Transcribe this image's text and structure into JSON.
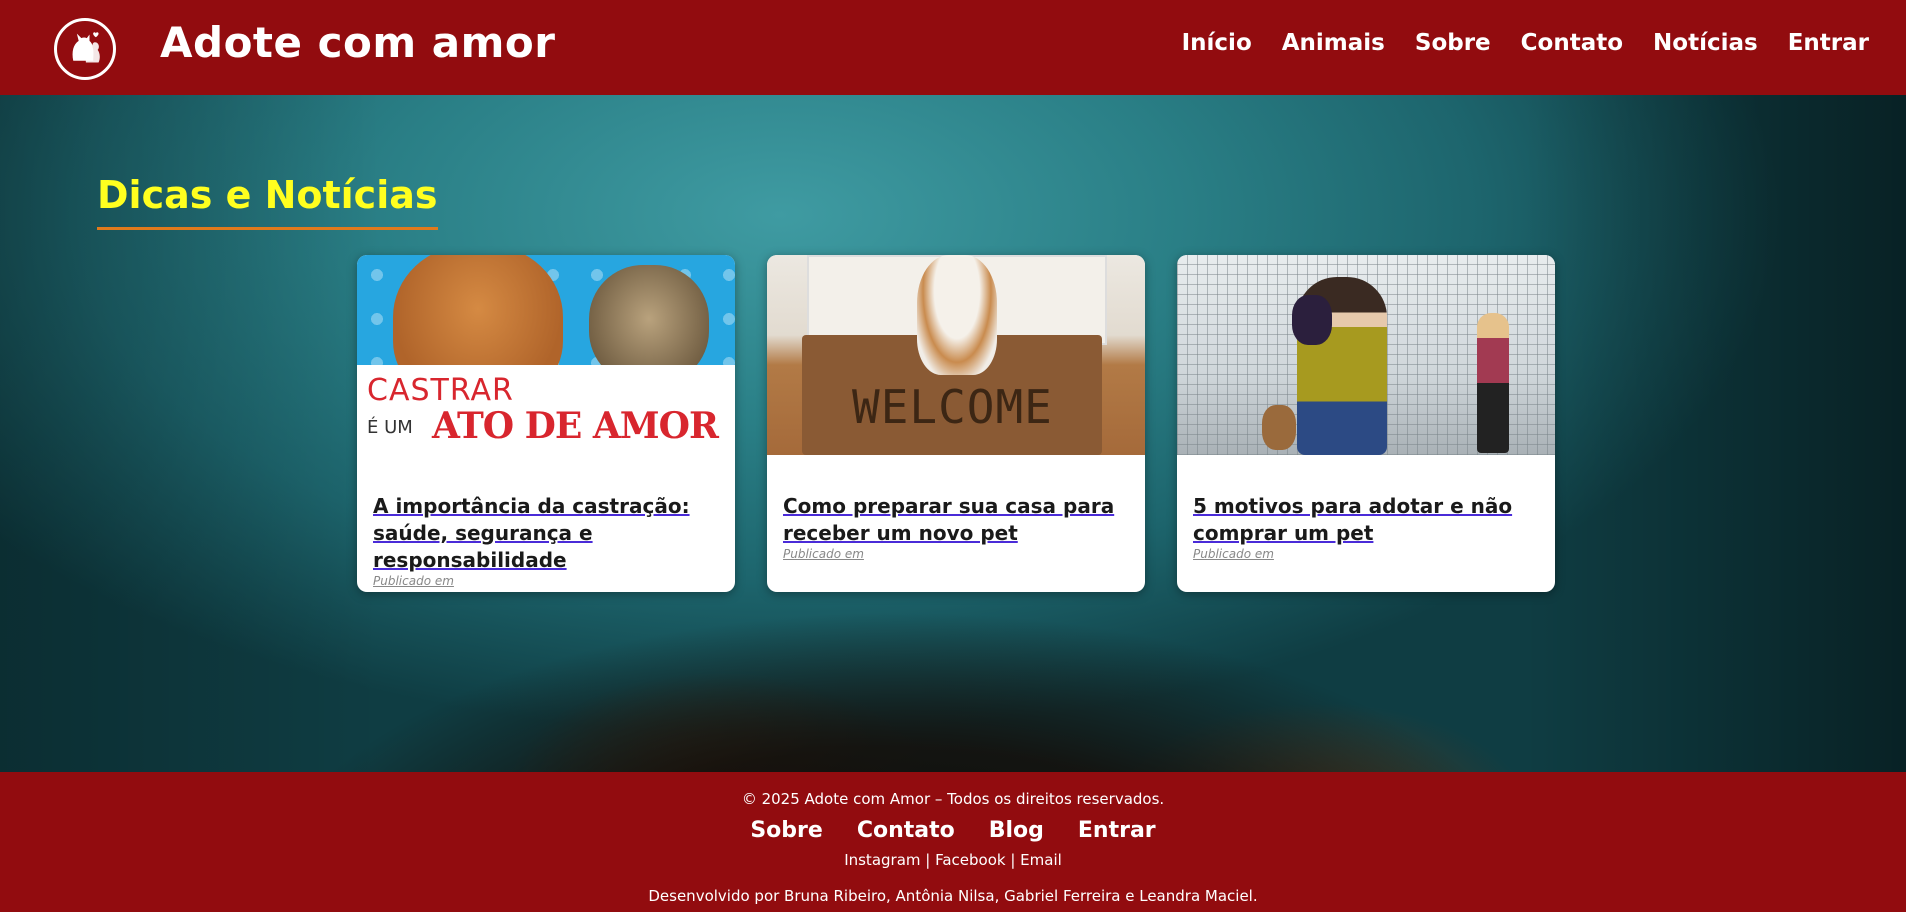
{
  "header": {
    "site_title": "Adote com amor",
    "logo_icon": "dog-cat-heart-logo",
    "nav": [
      "Início",
      "Animais",
      "Sobre",
      "Contato",
      "Notícias",
      "Entrar"
    ]
  },
  "hero": {
    "title": "Dicas e Notícias"
  },
  "cards": [
    {
      "image_text_1": "CASTRAR",
      "image_text_2": "É UM",
      "image_text_3": "ATO DE AMOR",
      "title": "A importância da castração: saúde, segurança e responsabilidade",
      "date": "Publicado em"
    },
    {
      "image_text_1": "WELCOME",
      "title": "Como preparar sua casa para receber um novo pet",
      "date": "Publicado em"
    },
    {
      "title": "5 motivos para adotar e não comprar um pet",
      "date": "Publicado em"
    }
  ],
  "footer": {
    "copyright": "© 2025 Adote com Amor – Todos os direitos reservados.",
    "nav": [
      "Sobre",
      "Contato",
      "Blog",
      "Entrar"
    ],
    "social": [
      "Instagram",
      "Facebook",
      "Email"
    ],
    "separator": " | ",
    "credits": "Desenvolvido por Bruna Ribeiro, Antônia Nilsa, Gabriel Ferreira e Leandra Maciel."
  },
  "colors": {
    "header_bg": "#920c0f",
    "title_yellow": "#ffff1f",
    "title_underline": "#e07a1c"
  }
}
